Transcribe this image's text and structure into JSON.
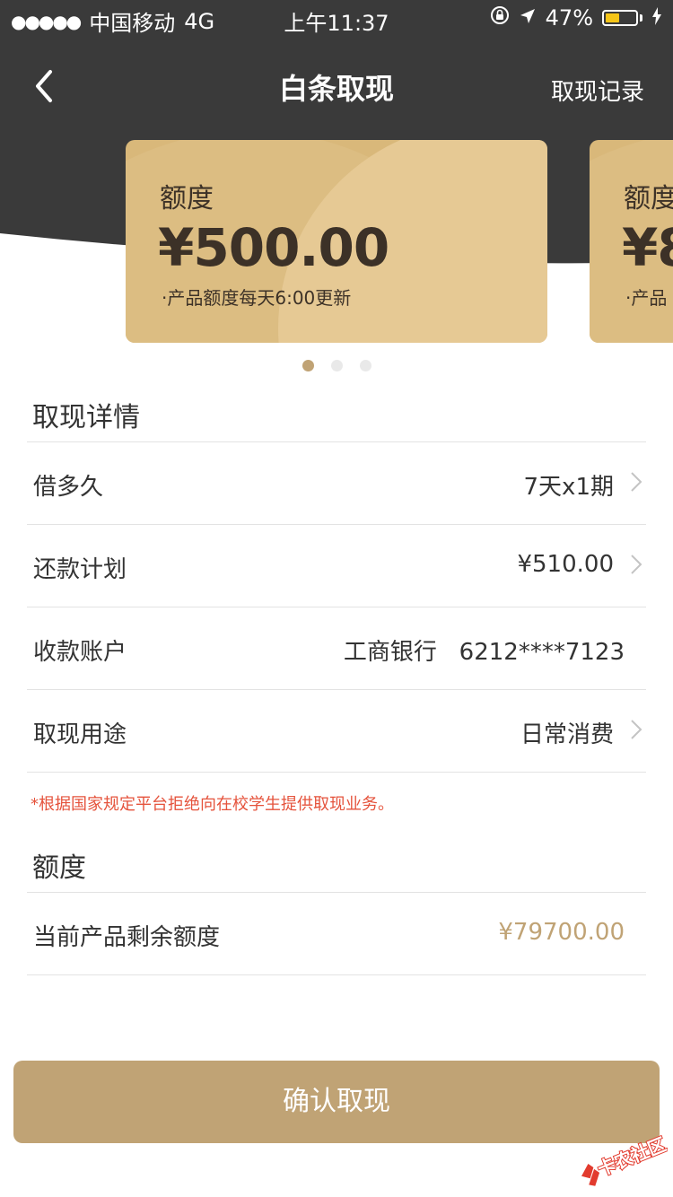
{
  "status_bar": {
    "signal": "●●●●●",
    "carrier": "中国移动",
    "network": "4G",
    "time": "上午11:37",
    "battery_percent": "47%",
    "battery_level": 0.47
  },
  "nav": {
    "title": "白条取现",
    "right_link": "取现记录"
  },
  "cards": [
    {
      "label": "额度",
      "amount": "¥500.00",
      "note": "·产品额度每天6:00更新"
    },
    {
      "label": "额度",
      "amount": "¥8",
      "note": "·产品"
    }
  ],
  "pager": {
    "total": 3,
    "active_index": 0
  },
  "details": {
    "title": "取现详情",
    "rows": [
      {
        "label": "借多久",
        "value": "7天x1期"
      },
      {
        "label": "还款计划",
        "value": "¥510.00"
      },
      {
        "label": "收款账户",
        "value": "工商银行   6212****7123"
      },
      {
        "label": "取现用途",
        "value": "日常消费"
      }
    ]
  },
  "notice": "*根据国家规定平台拒绝向在校学生提供取现业务。",
  "quota": {
    "title": "额度",
    "row": {
      "label": "当前产品剩余额度",
      "value": "¥79700.00"
    }
  },
  "confirm_label": "确认取现",
  "watermark_text": "卡农社区",
  "colors": {
    "header_dark": "#3a3a3a",
    "gold": "#c0a375",
    "card_gold": "#dcbe83",
    "notice_red": "#e5533c"
  }
}
